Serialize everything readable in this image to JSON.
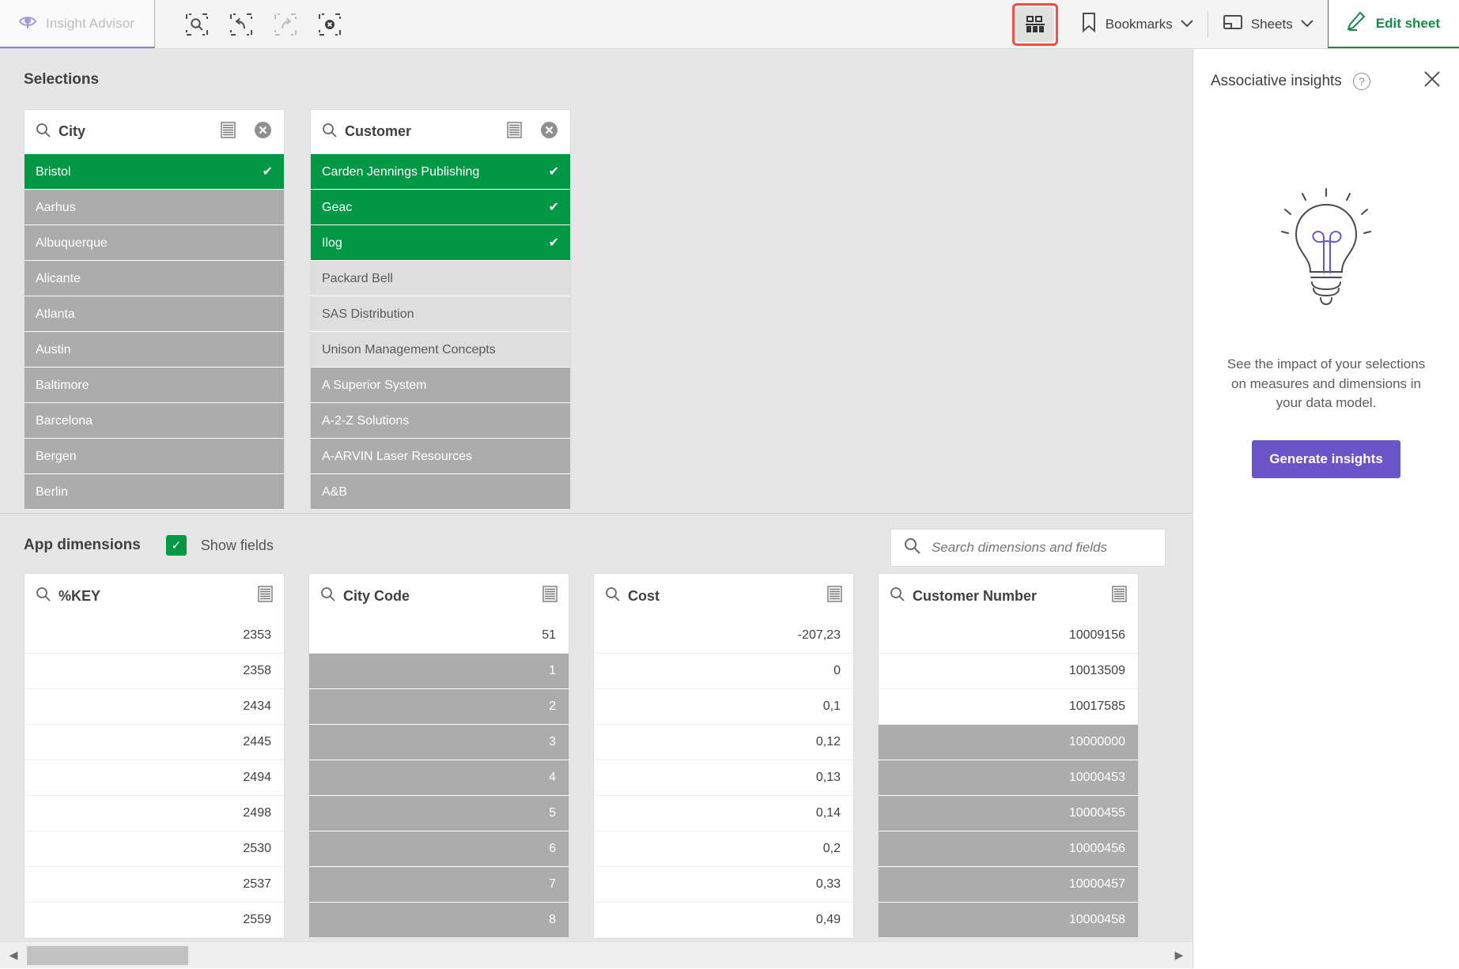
{
  "toolbar": {
    "insight_advisor_label": "Insight Advisor",
    "icons": [
      {
        "name": "smart-search-icon",
        "label": "Smart search"
      },
      {
        "name": "step-back-icon",
        "label": "Step back"
      },
      {
        "name": "step-forward-icon",
        "label": "Step forward"
      },
      {
        "name": "clear-selections-icon",
        "label": "Clear all selections"
      }
    ],
    "associative_insights_label": "Associative insights",
    "bookmarks_label": "Bookmarks",
    "sheets_label": "Sheets",
    "edit_sheet_label": "Edit sheet",
    "highlight_color": "#fb4c42",
    "accent_green": "#178a45"
  },
  "selections": {
    "title": "Selections",
    "listboxes": [
      {
        "field": "City",
        "has_clear": true,
        "rows": [
          {
            "label": "Bristol",
            "state": "sel"
          },
          {
            "label": "Aarhus",
            "state": "excl"
          },
          {
            "label": "Albuquerque",
            "state": "excl"
          },
          {
            "label": "Alicante",
            "state": "excl"
          },
          {
            "label": "Atlanta",
            "state": "excl"
          },
          {
            "label": "Austin",
            "state": "excl"
          },
          {
            "label": "Baltimore",
            "state": "excl"
          },
          {
            "label": "Barcelona",
            "state": "excl"
          },
          {
            "label": "Bergen",
            "state": "excl"
          },
          {
            "label": "Berlin",
            "state": "excl"
          }
        ]
      },
      {
        "field": "Customer",
        "has_clear": true,
        "rows": [
          {
            "label": "Carden Jennings Publishing",
            "state": "sel"
          },
          {
            "label": "Geac",
            "state": "sel"
          },
          {
            "label": "Ilog",
            "state": "sel"
          },
          {
            "label": "Packard Bell",
            "state": "alt"
          },
          {
            "label": "SAS Distribution",
            "state": "alt"
          },
          {
            "label": "Unison Management Concepts",
            "state": "alt"
          },
          {
            "label": "A Superior System",
            "state": "excl"
          },
          {
            "label": "A-2-Z Solutions",
            "state": "excl"
          },
          {
            "label": "A-ARVIN Laser Resources",
            "state": "excl"
          },
          {
            "label": "A&B",
            "state": "excl"
          }
        ]
      }
    ]
  },
  "app_dimensions": {
    "title": "App dimensions",
    "show_fields_label": "Show fields",
    "show_fields_checked": true,
    "search_placeholder": "Search dimensions and fields",
    "search_value": "",
    "fields": [
      {
        "field": "%KEY",
        "rows": [
          {
            "label": "2353",
            "state": "opt"
          },
          {
            "label": "2358",
            "state": "opt"
          },
          {
            "label": "2434",
            "state": "opt"
          },
          {
            "label": "2445",
            "state": "opt"
          },
          {
            "label": "2494",
            "state": "opt"
          },
          {
            "label": "2498",
            "state": "opt"
          },
          {
            "label": "2530",
            "state": "opt"
          },
          {
            "label": "2537",
            "state": "opt"
          },
          {
            "label": "2559",
            "state": "opt"
          }
        ]
      },
      {
        "field": "City Code",
        "rows": [
          {
            "label": "51",
            "state": "opt"
          },
          {
            "label": "1",
            "state": "excl"
          },
          {
            "label": "2",
            "state": "excl"
          },
          {
            "label": "3",
            "state": "excl"
          },
          {
            "label": "4",
            "state": "excl"
          },
          {
            "label": "5",
            "state": "excl"
          },
          {
            "label": "6",
            "state": "excl"
          },
          {
            "label": "7",
            "state": "excl"
          },
          {
            "label": "8",
            "state": "excl"
          }
        ]
      },
      {
        "field": "Cost",
        "rows": [
          {
            "label": "-207,23",
            "state": "opt"
          },
          {
            "label": "0",
            "state": "opt"
          },
          {
            "label": "0,1",
            "state": "opt"
          },
          {
            "label": "0,12",
            "state": "opt"
          },
          {
            "label": "0,13",
            "state": "opt"
          },
          {
            "label": "0,14",
            "state": "opt"
          },
          {
            "label": "0,2",
            "state": "opt"
          },
          {
            "label": "0,33",
            "state": "opt"
          },
          {
            "label": "0,49",
            "state": "opt"
          }
        ]
      },
      {
        "field": "Customer Number",
        "rows": [
          {
            "label": "10009156",
            "state": "opt"
          },
          {
            "label": "10013509",
            "state": "opt"
          },
          {
            "label": "10017585",
            "state": "opt"
          },
          {
            "label": "10000000",
            "state": "excl"
          },
          {
            "label": "10000453",
            "state": "excl"
          },
          {
            "label": "10000455",
            "state": "excl"
          },
          {
            "label": "10000456",
            "state": "excl"
          },
          {
            "label": "10000457",
            "state": "excl"
          },
          {
            "label": "10000458",
            "state": "excl"
          }
        ]
      }
    ]
  },
  "insights_panel": {
    "title": "Associative insights",
    "description": "See the impact of your selections on measures and dimensions in your data model.",
    "button_label": "Generate insights",
    "button_color": "#6a55c8"
  }
}
